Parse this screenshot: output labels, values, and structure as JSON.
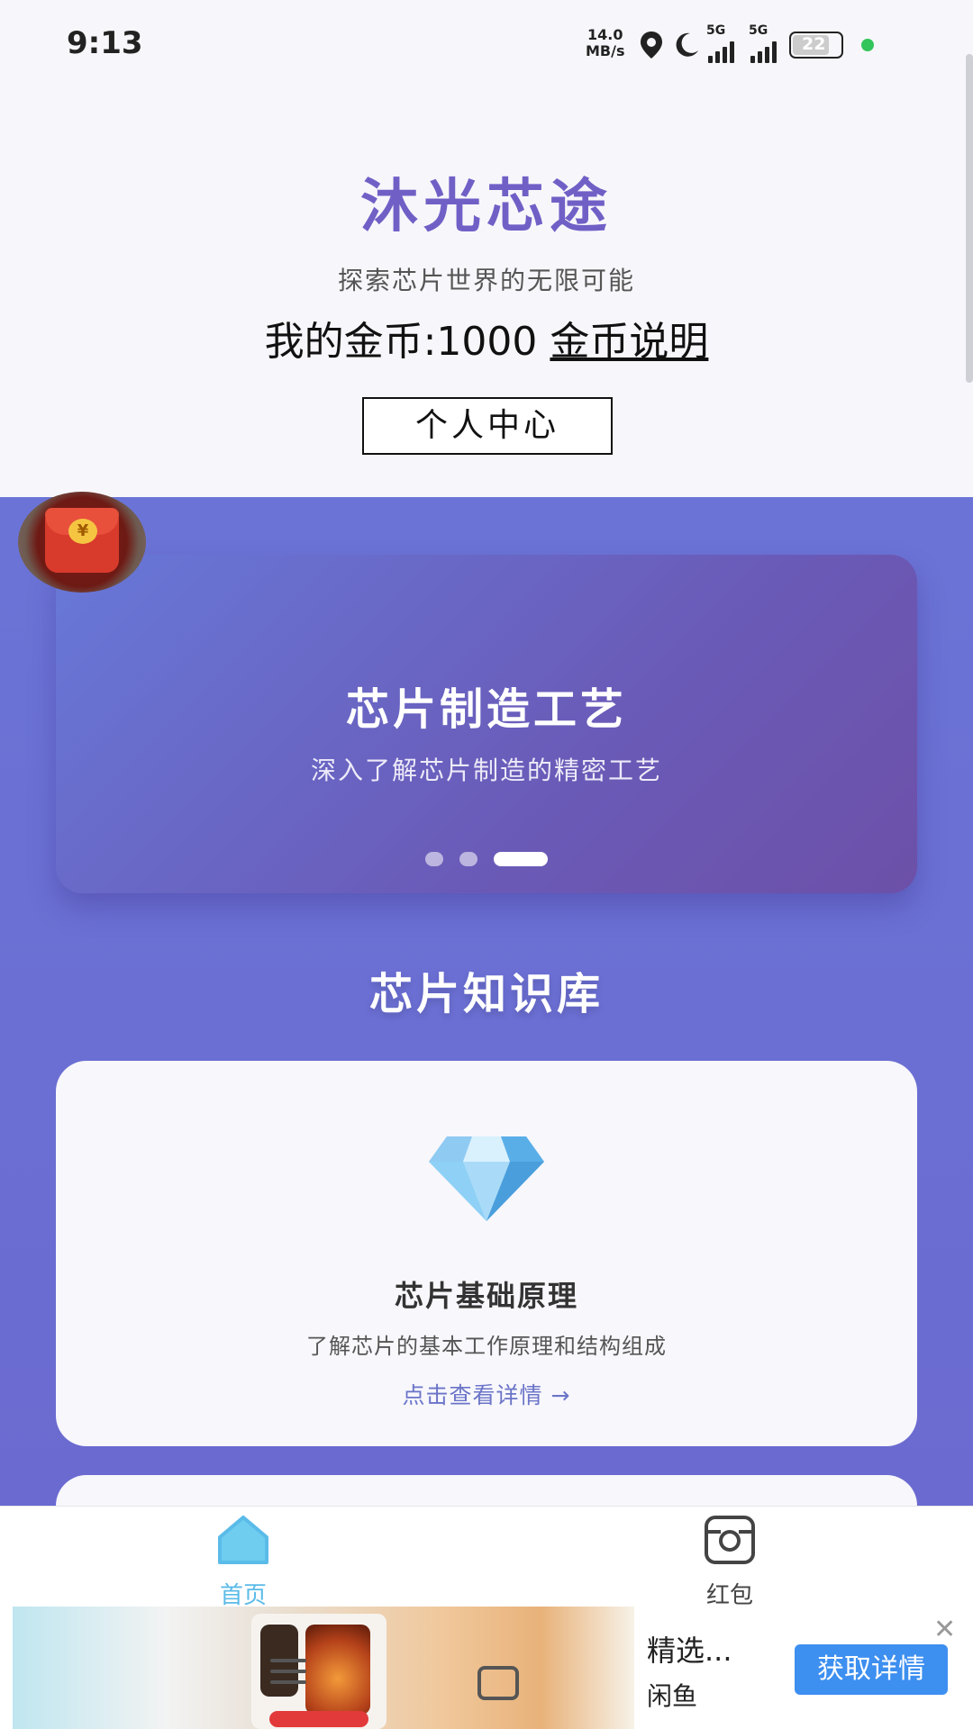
{
  "status_bar": {
    "time": "9:13",
    "net_speed_value": "14.0",
    "net_speed_unit": "MB/s",
    "signal1_label": "5G",
    "signal2_label": "5G",
    "battery": "22"
  },
  "header": {
    "title": "沐光芯途",
    "subtitle": "探索芯片世界的无限可能",
    "coins_label": "我的金币:1000",
    "coins_help_link": "金币说明",
    "profile_button": "个人中心"
  },
  "banner": {
    "title": "芯片制造工艺",
    "subtitle": "深入了解芯片制造的精密工艺",
    "slide_count": 3,
    "active_slide": 3
  },
  "knowledge": {
    "section_title": "芯片知识库",
    "cards": [
      {
        "icon": "diamond-icon",
        "title": "芯片基础原理",
        "description": "了解芯片的基本工作原理和结构组成",
        "link": "点击查看详情 →"
      }
    ]
  },
  "red_packet": {
    "icon": "red-packet-icon",
    "coin_symbol": "¥"
  },
  "tabbar": {
    "tabs": [
      {
        "label": "首页",
        "icon": "home-icon",
        "active": true
      },
      {
        "label": "红包",
        "icon": "camera-icon",
        "active": false
      }
    ]
  },
  "ad": {
    "title": "精选...",
    "brand": "闲鱼",
    "cta": "获取详情",
    "close": "✕"
  },
  "colors": {
    "accent": "#7060c6",
    "content_bg": "#6b74d6",
    "tab_active": "#5bbbe8",
    "ad_button": "#3d8ff0"
  }
}
